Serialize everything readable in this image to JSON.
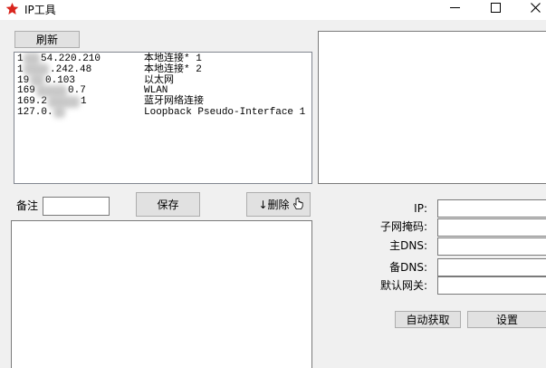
{
  "window": {
    "title": "IP工具"
  },
  "left_panel": {
    "refresh_label": "刷新",
    "adapters": [
      {
        "ip_prefix": "1",
        "ip_suffix": "54.220.210",
        "name": "本地连接* 1"
      },
      {
        "ip_prefix": "1",
        "ip_suffix": ".242.48",
        "name": "本地连接* 2"
      },
      {
        "ip_prefix": "19",
        "ip_suffix": "0.103",
        "name": "以太网"
      },
      {
        "ip_prefix": "169",
        "ip_suffix": "0.7",
        "name": "WLAN"
      },
      {
        "ip_prefix": "169.2",
        "ip_suffix": "1",
        "name": "蓝牙网络连接"
      },
      {
        "ip_prefix": "127.0.",
        "name": "Loopback Pseudo-Interface 1"
      }
    ],
    "note_label": "备注",
    "note_value": "",
    "save_label": "保存",
    "delete_label": "↓删除",
    "log_text": ""
  },
  "right_panel": {
    "info_text": "",
    "fields": [
      {
        "label": "IP:",
        "value": ""
      },
      {
        "label": "子网掩码:",
        "value": ""
      },
      {
        "label": "主DNS:",
        "value": ""
      },
      {
        "label": "备DNS:",
        "value": ""
      },
      {
        "label": "默认网关:",
        "value": ""
      }
    ],
    "auto_label": "自动获取",
    "set_label": "设置"
  },
  "icons": {
    "app": "red-star-icon",
    "minimize": "minimize-icon",
    "maximize": "maximize-icon",
    "close": "close-icon",
    "cursor": "hand-cursor-icon"
  },
  "colors": {
    "app_icon": "#d9251d",
    "window_bg": "#f0f0f0",
    "titlebar_bg": "#ffffff",
    "button_bg": "#e1e1e1",
    "button_border": "#adadad",
    "field_border": "#7a7a7a"
  }
}
